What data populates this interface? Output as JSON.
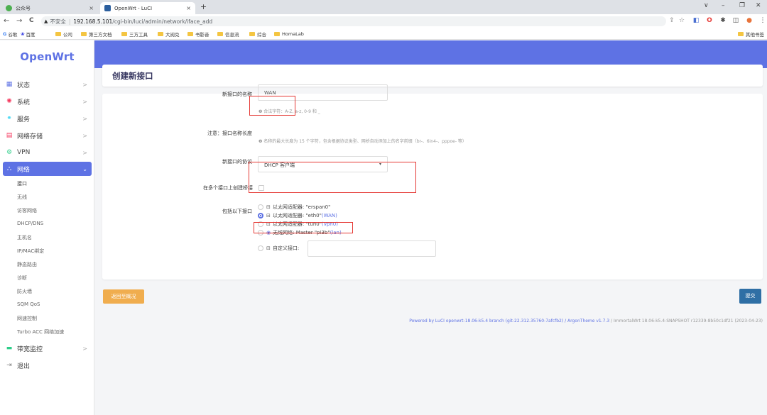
{
  "browser": {
    "tabs": [
      {
        "label": "公众号",
        "close": "×"
      },
      {
        "label": "OpenWrt - LuCI",
        "close": "×"
      }
    ],
    "new_tab": "+",
    "window_controls": {
      "chevron": "∨",
      "minimize": "–",
      "restore": "❐",
      "close": "✕"
    },
    "nav": {
      "back": "←",
      "forward": "→",
      "reload": "C"
    },
    "address": {
      "security_icon": "▲",
      "security_label": "不安全",
      "separator": "|",
      "host": "192.168.5.101",
      "path": "/cgi-bin/luci/admin/network/iface_add"
    },
    "bookmarks": [
      "谷歌",
      "百度",
      "公司",
      "第三方文档",
      "三方工具",
      "大阅兑",
      "书影音",
      "信息流",
      "综合",
      "HomaLab"
    ],
    "other_bookmarks": "其他书签"
  },
  "sidebar": {
    "logo": "OpenWrt",
    "items": [
      {
        "label": "状态",
        "icon": "grid-icon",
        "chev": ">"
      },
      {
        "label": "系统",
        "icon": "gear-icon",
        "chev": ">"
      },
      {
        "label": "服务",
        "icon": "share-icon",
        "chev": ">"
      },
      {
        "label": "网络存储",
        "icon": "storage-icon",
        "chev": ">"
      },
      {
        "label": "VPN",
        "icon": "vpn-icon",
        "chev": ">"
      },
      {
        "label": "网络",
        "icon": "network-icon",
        "chev": "⌄"
      },
      {
        "label": "带宽监控",
        "icon": "monitor-icon",
        "chev": ">"
      },
      {
        "label": "退出",
        "icon": "logout-icon",
        "chev": ""
      }
    ],
    "network_sub": [
      "接口",
      "无线",
      "访客网络",
      "DHCP/DNS",
      "主机名",
      "IP/MAC绑定",
      "静态路由",
      "诊断",
      "防火墙",
      "SQM QoS",
      "网速控制",
      "Turbo ACC 网络加速"
    ]
  },
  "page": {
    "title": "创建新接口",
    "form": {
      "name_label": "新接口的名称",
      "name_value": "WAN",
      "name_hint": "❷ 合法字符：A-Z, a-z, 0-9 和 _",
      "note_label": "注意：接口名称长度",
      "note_text": "❷ 名称的最大长度为 15 个字符，包含根据协议类型、网桥自动添加上的名字前缀（br-、6in4-、pppoe- 等）",
      "protocol_label": "新接口的协议",
      "protocol_value": "DHCP 客户端",
      "protocol_caret": "▾",
      "bridge_label": "在多个接口上创建桥接",
      "include_label": "包括以下接口",
      "interfaces": [
        {
          "prefix": "以太网适配器: \"erspan0\"",
          "suffix": "",
          "checked": false
        },
        {
          "prefix": "以太网适配器: \"eth0\"",
          "suffix": " (WAN)",
          "checked": true
        },
        {
          "prefix": "以太网适配器: \"tun0\"",
          "suffix": " (vpn0)",
          "checked": false
        },
        {
          "prefix": "无线网络: Master \"pi3b\"",
          "suffix": " (lan)",
          "checked": false
        }
      ],
      "custom_label": "自定义接口:"
    },
    "back_button": "返回至概况",
    "submit_button": "提交",
    "footer_main": "Powered by LuCI openwrt-18.06-k5.4 branch (git-22.312.35760-7afcfb2) / ArgonTheme v1.7.3",
    "footer_muted": " / ImmortalWrt 18.06-k5.4-SNAPSHOT r12339-8b50c1df21 (2023-04-23)"
  },
  "colors": {
    "accent": "#5e72e4",
    "back_button": "#f0ad4e",
    "submit_button": "#2f6fa5",
    "highlight": "#e53935"
  }
}
